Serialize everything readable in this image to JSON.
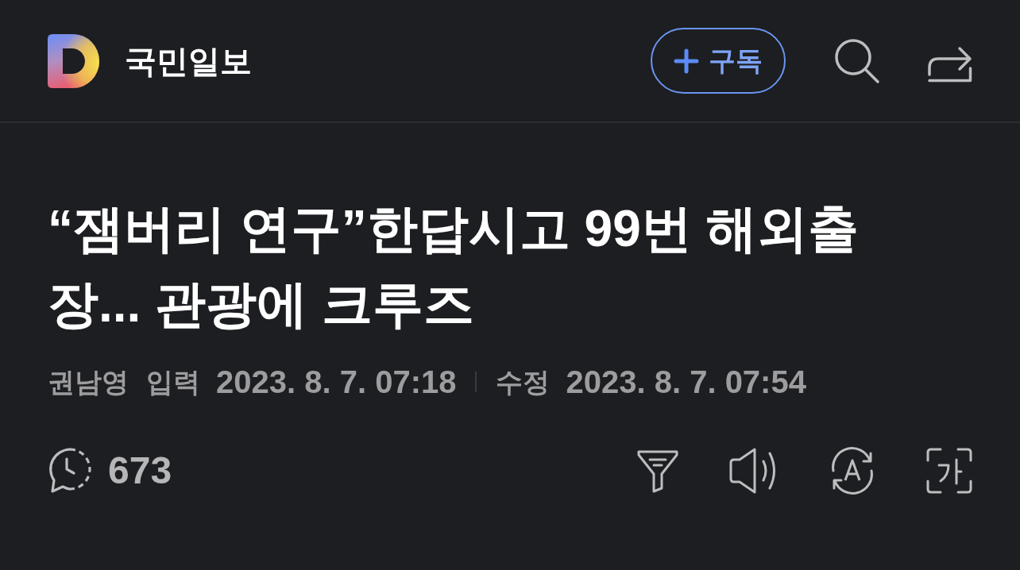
{
  "header": {
    "publisher": "국민일보",
    "subscribe_button": "구독"
  },
  "headline": "“잼버리 연구”한답시고 99번 해외출장... 관광에 크루즈",
  "byline": {
    "author": "권남영",
    "input_label": "입력",
    "input_date": "2023. 8. 7. 07:18",
    "modified_label": "수정",
    "modified_date": "2023. 8. 7. 07:54"
  },
  "toolbar": {
    "comment_count": "673"
  }
}
